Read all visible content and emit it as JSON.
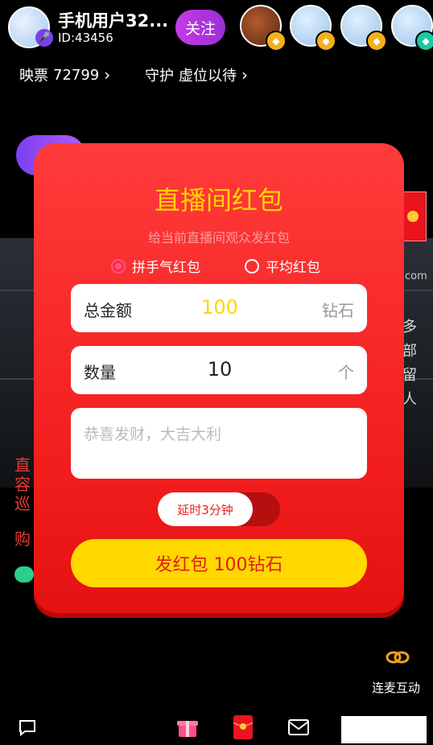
{
  "host": {
    "name": "手机用户32...",
    "id": "ID:43456",
    "follow_label": "关注"
  },
  "viewers": [
    {
      "icon": "roast-avatar",
      "badge": "vip-gold"
    },
    {
      "icon": "mouse-avatar",
      "badge": "vip-gold"
    },
    {
      "icon": "mouse-avatar",
      "badge": "vip-gold"
    },
    {
      "icon": "mouse-avatar",
      "badge": "vip-teal"
    }
  ],
  "stats": {
    "tickets_label": "映票",
    "tickets_value": "72799",
    "guard_label": "守护",
    "guard_value": "虚位以待"
  },
  "background": {
    "left_text": [
      "直",
      "容",
      "巡"
    ],
    "buy_text": "购",
    "right_text": [
      "多",
      "部",
      "留",
      "人"
    ],
    "right_domain": "com"
  },
  "modal": {
    "title": "直播间红包",
    "subtitle": "给当前直播间观众发红包",
    "options": [
      {
        "label": "拼手气红包",
        "selected": true
      },
      {
        "label": "平均红包",
        "selected": false
      }
    ],
    "amount": {
      "label": "总金额",
      "value": "100",
      "unit": "钻石"
    },
    "count": {
      "label": "数量",
      "value": "10",
      "unit": "个"
    },
    "message_placeholder": "恭喜发财，大吉大利",
    "delay_label": "延时3分钟",
    "delay_enabled": false,
    "send_label": "发红包 100钻石"
  },
  "bottom": {
    "mic_link_label": "连麦互动",
    "icons": [
      "chat-icon",
      "gift-icon",
      "red-packet-icon",
      "mail-icon"
    ]
  },
  "colors": {
    "modal_red": "#f21d1d",
    "title_yellow": "#ffd400",
    "send_yellow": "#ffd800",
    "follow_purple": "#b035e0",
    "radio_pink": "#ff4f8b"
  }
}
